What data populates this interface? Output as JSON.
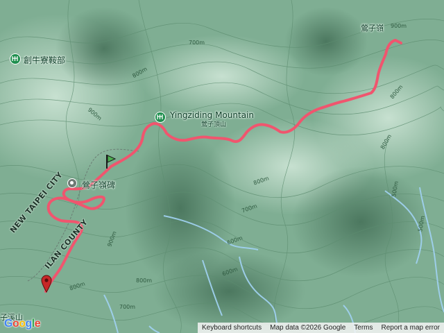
{
  "map": {
    "pois": [
      {
        "name": "創牛寮鞍部",
        "icon": "hiking-icon"
      },
      {
        "name": "Yingziding Mountain",
        "sub": "鶯子頂山",
        "icon": "hiking-icon"
      },
      {
        "name": "鶯子嶺碑",
        "icon": "landmark-icon"
      }
    ],
    "peak_label": "鶯子嶺",
    "region_label": "NEW TAIPEI CITY",
    "county_label": "ILAN COUNTY",
    "edge_label": "子溪山",
    "contours": [
      "900m",
      "700m",
      "800m",
      "900m",
      "800m",
      "800m",
      "800m",
      "700m",
      "900m",
      "600m",
      "600m",
      "800m",
      "800m",
      "700m",
      "500m",
      "500m"
    ],
    "track_color": "#f0556e",
    "start_marker_color": "#1a1a1a",
    "end_marker_color": "#c62828"
  },
  "google_logo": "Google",
  "attribution": {
    "shortcuts": "Keyboard shortcuts",
    "map_data": "Map data ©2026 Google",
    "terms": "Terms",
    "report": "Report a map error"
  }
}
